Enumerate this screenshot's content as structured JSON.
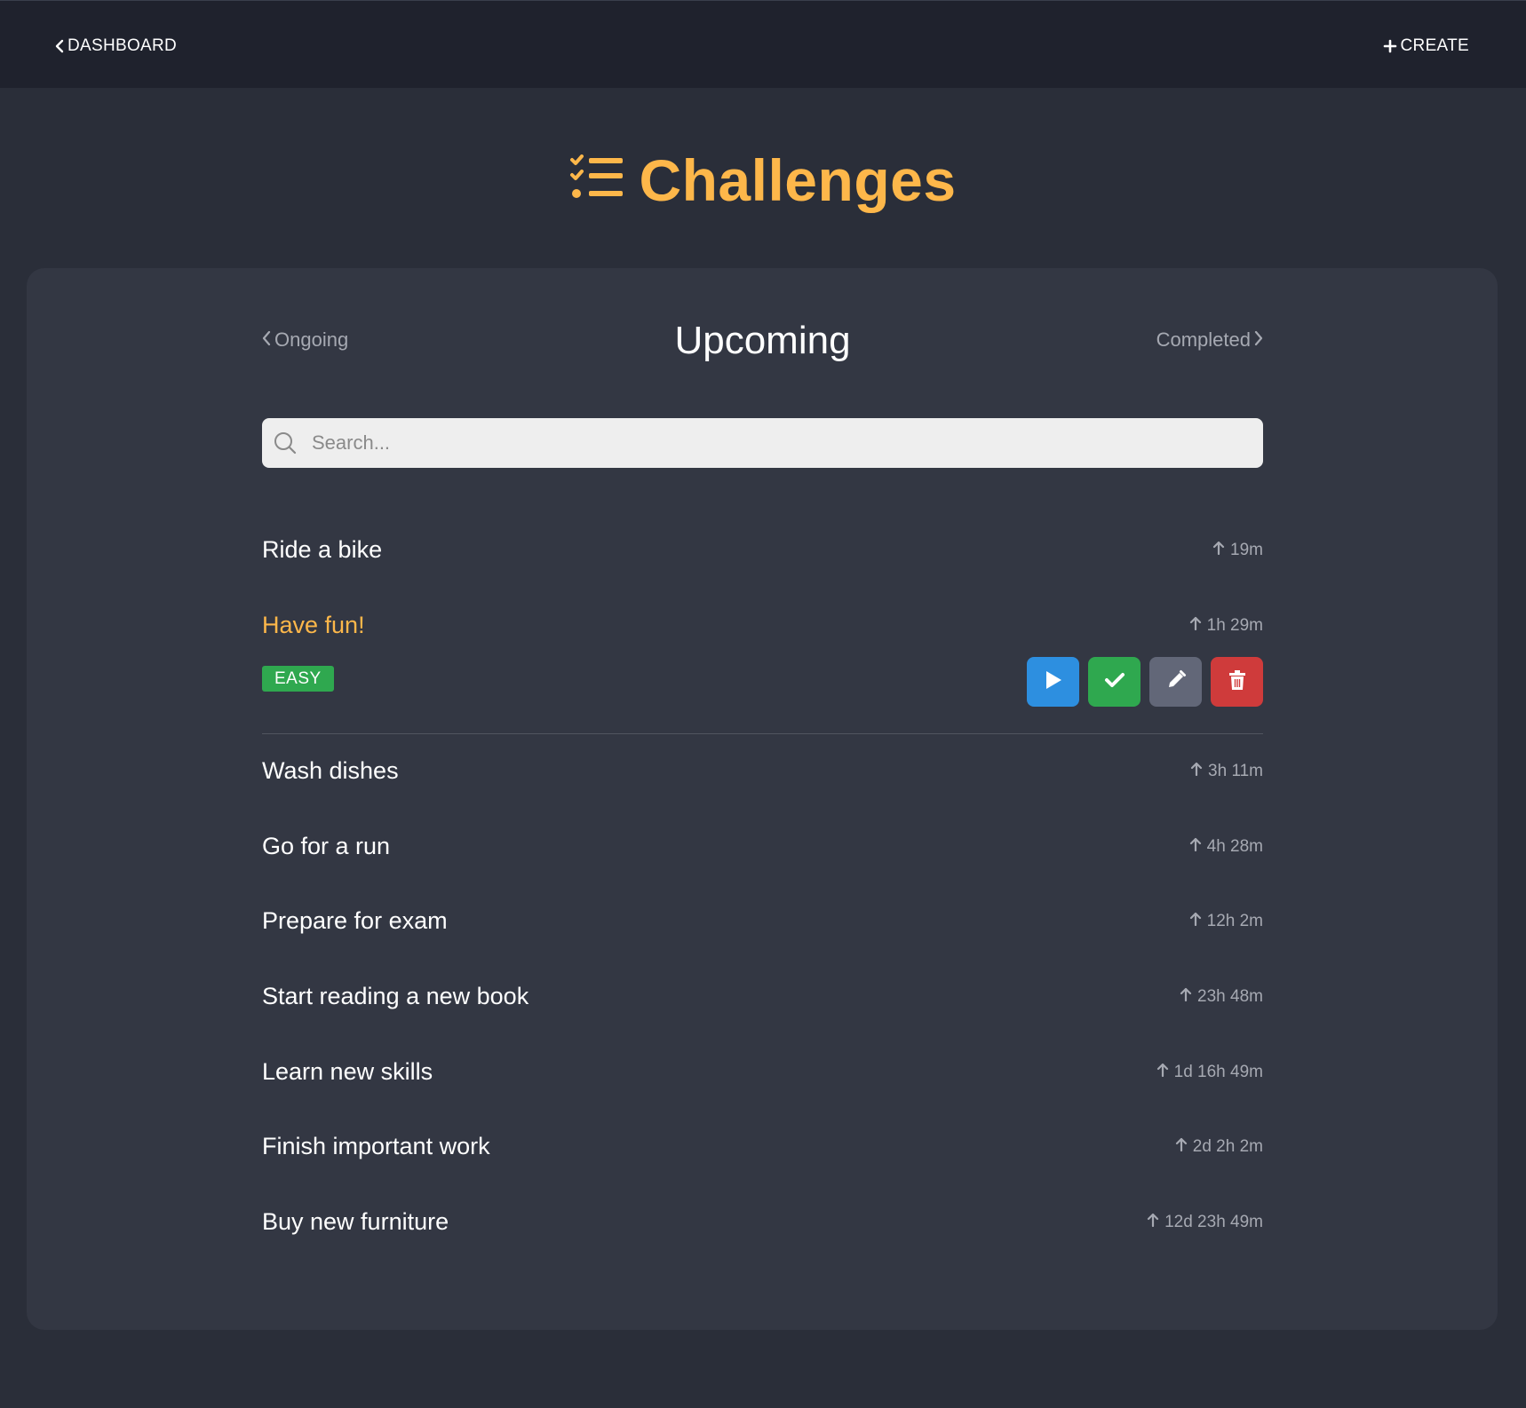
{
  "topbar": {
    "back_label": "DASHBOARD",
    "create_label": "CREATE"
  },
  "page": {
    "title": "Challenges",
    "title_color": "#fdb74a"
  },
  "tabs": {
    "previous": "Ongoing",
    "current": "Upcoming",
    "next": "Completed"
  },
  "search": {
    "placeholder": "Search..."
  },
  "challenges": [
    {
      "title": "Ride a bike",
      "time": "19m"
    },
    {
      "title": "Have fun!",
      "time": "1h 29m",
      "selected": true,
      "difficulty": "EASY"
    },
    {
      "title": "Wash dishes",
      "time": "3h 11m"
    },
    {
      "title": "Go for a run",
      "time": "4h 28m"
    },
    {
      "title": "Prepare for exam",
      "time": "12h 2m"
    },
    {
      "title": "Start reading a new book",
      "time": "23h 48m"
    },
    {
      "title": "Learn new skills",
      "time": "1d 16h 49m"
    },
    {
      "title": "Finish important work",
      "time": "2d 2h 2m"
    },
    {
      "title": "Buy new furniture",
      "time": "12d 23h 49m"
    }
  ],
  "actions": {
    "start_icon": "play-icon",
    "complete_icon": "check-icon",
    "edit_icon": "pencil-icon",
    "delete_icon": "trash-icon",
    "start_color": "#2d8fe0",
    "complete_color": "#2fa84f",
    "edit_color": "#626778",
    "delete_color": "#cf3b3b"
  }
}
